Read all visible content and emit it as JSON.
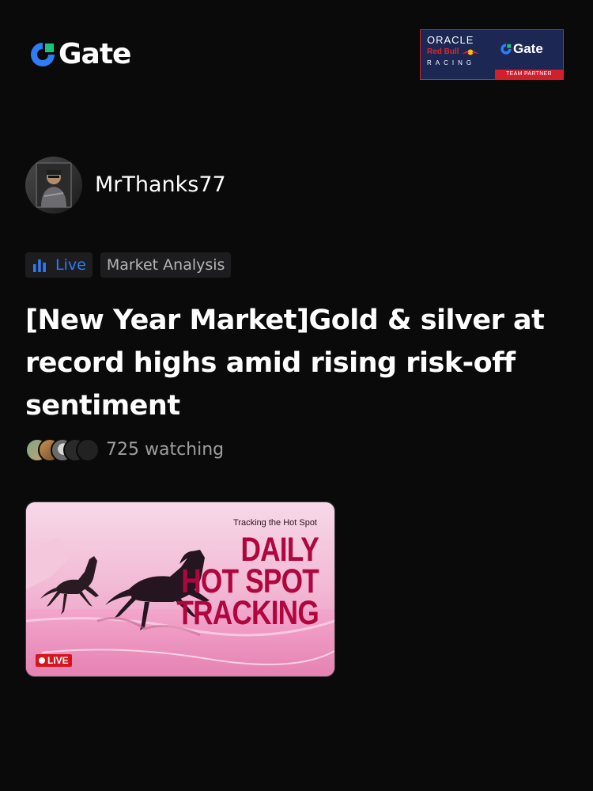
{
  "brand": {
    "logo_text": "Gate",
    "logo_icon": "gate-logo-icon",
    "accent_color": "#2f7cf6"
  },
  "partner_badge": {
    "line1": "ORACLE",
    "line2": "Red Bull",
    "line3": "RACING",
    "partner_name": "Gate",
    "footer": "TEAM PARTNER",
    "color_red": "#d11f2e",
    "color_navy": "#1d2753"
  },
  "author": {
    "name": "MrThanks77",
    "avatar_icon": "user-avatar"
  },
  "tags": [
    {
      "label": "Live",
      "icon": "bar-chart-icon",
      "color": "#2f7cf6"
    },
    {
      "label": "Market Analysis"
    }
  ],
  "post": {
    "title": "[New Year Market]Gold & silver at record highs amid rising risk-off sentiment"
  },
  "watching": {
    "count_text": "725 watching"
  },
  "stream_card": {
    "subtitle": "Tracking the Hot Spot",
    "headline_lines": [
      "DAILY",
      "HOT SPOT",
      "TRACKING"
    ],
    "live_label": "LIVE",
    "headline_color": "#b0063e",
    "live_color": "#d8151f"
  }
}
